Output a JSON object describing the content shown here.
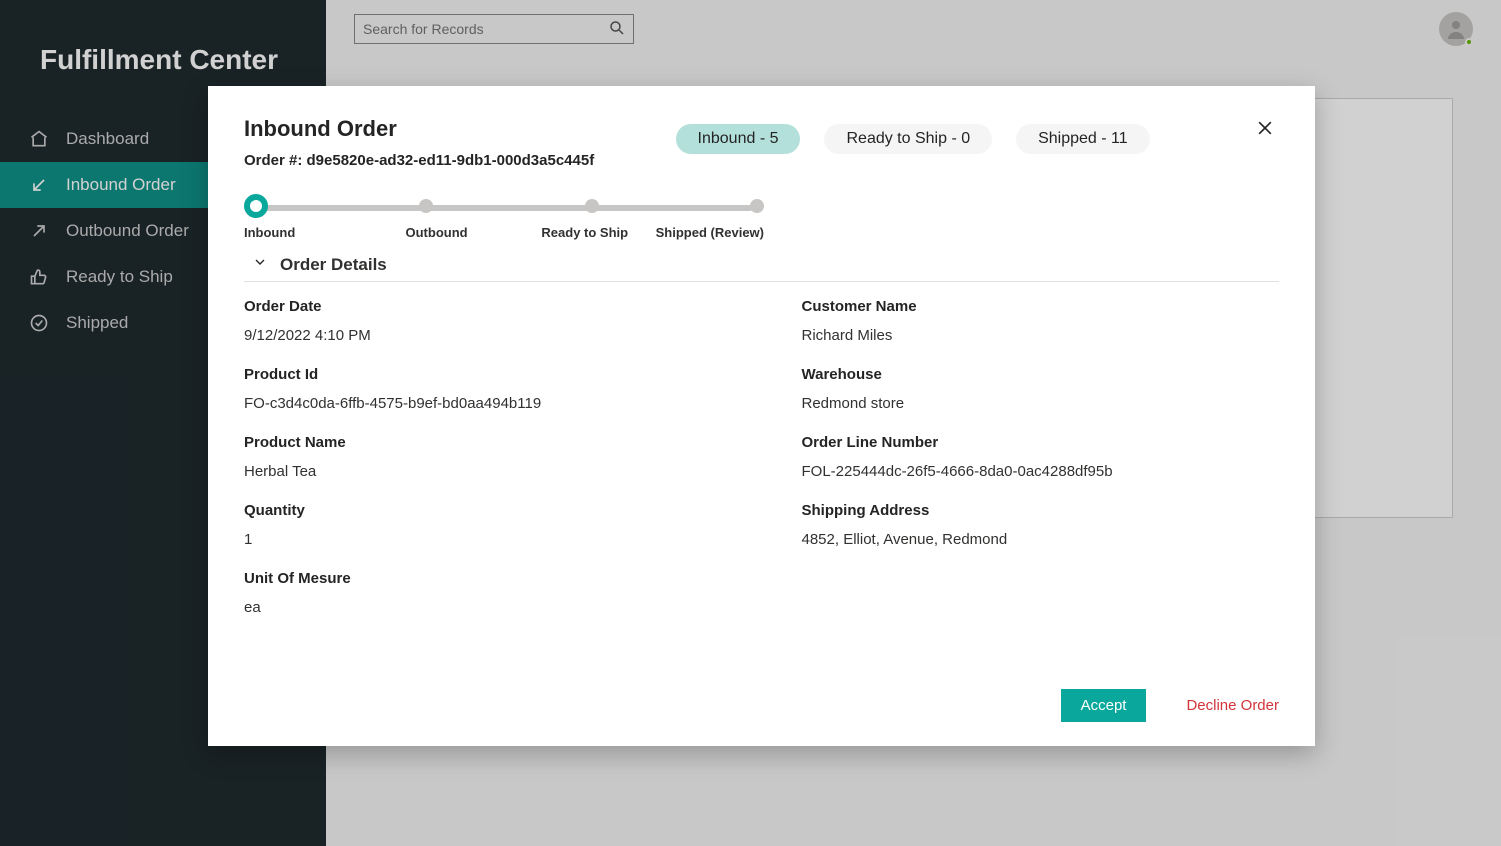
{
  "brand": "Fulfillment Center",
  "search_placeholder": "Search for Records",
  "sidebar": {
    "items": [
      {
        "label": "Dashboard"
      },
      {
        "label": "Inbound Order"
      },
      {
        "label": "Outbound Order"
      },
      {
        "label": "Ready to Ship"
      },
      {
        "label": "Shipped"
      }
    ]
  },
  "modal": {
    "title": "Inbound Order",
    "order_number_label": "Order #: d9e5820e-ad32-ed11-9db1-000d3a5c445f",
    "pills": [
      {
        "label": "Inbound - 5"
      },
      {
        "label": "Ready to Ship - 0"
      },
      {
        "label": "Shipped - 11"
      }
    ],
    "steps": [
      "Inbound",
      "Outbound",
      "Ready to Ship",
      "Shipped (Review)"
    ],
    "section_title": "Order Details",
    "fields_left": [
      {
        "label": "Order Date",
        "value": "9/12/2022 4:10 PM"
      },
      {
        "label": "Product Id",
        "value": "FO-c3d4c0da-6ffb-4575-b9ef-bd0aa494b119"
      },
      {
        "label": "Product Name",
        "value": "Herbal Tea"
      },
      {
        "label": "Quantity",
        "value": "1"
      },
      {
        "label": "Unit Of Mesure",
        "value": "ea"
      }
    ],
    "fields_right": [
      {
        "label": "Customer Name",
        "value": "Richard Miles"
      },
      {
        "label": "Warehouse",
        "value": "Redmond store"
      },
      {
        "label": "Order Line Number",
        "value": "FOL-225444dc-26f5-4666-8da0-0ac4288df95b"
      },
      {
        "label": "Shipping Address",
        "value": "4852, Elliot, Avenue, Redmond"
      }
    ],
    "accept_label": "Accept",
    "decline_label": "Decline Order"
  }
}
